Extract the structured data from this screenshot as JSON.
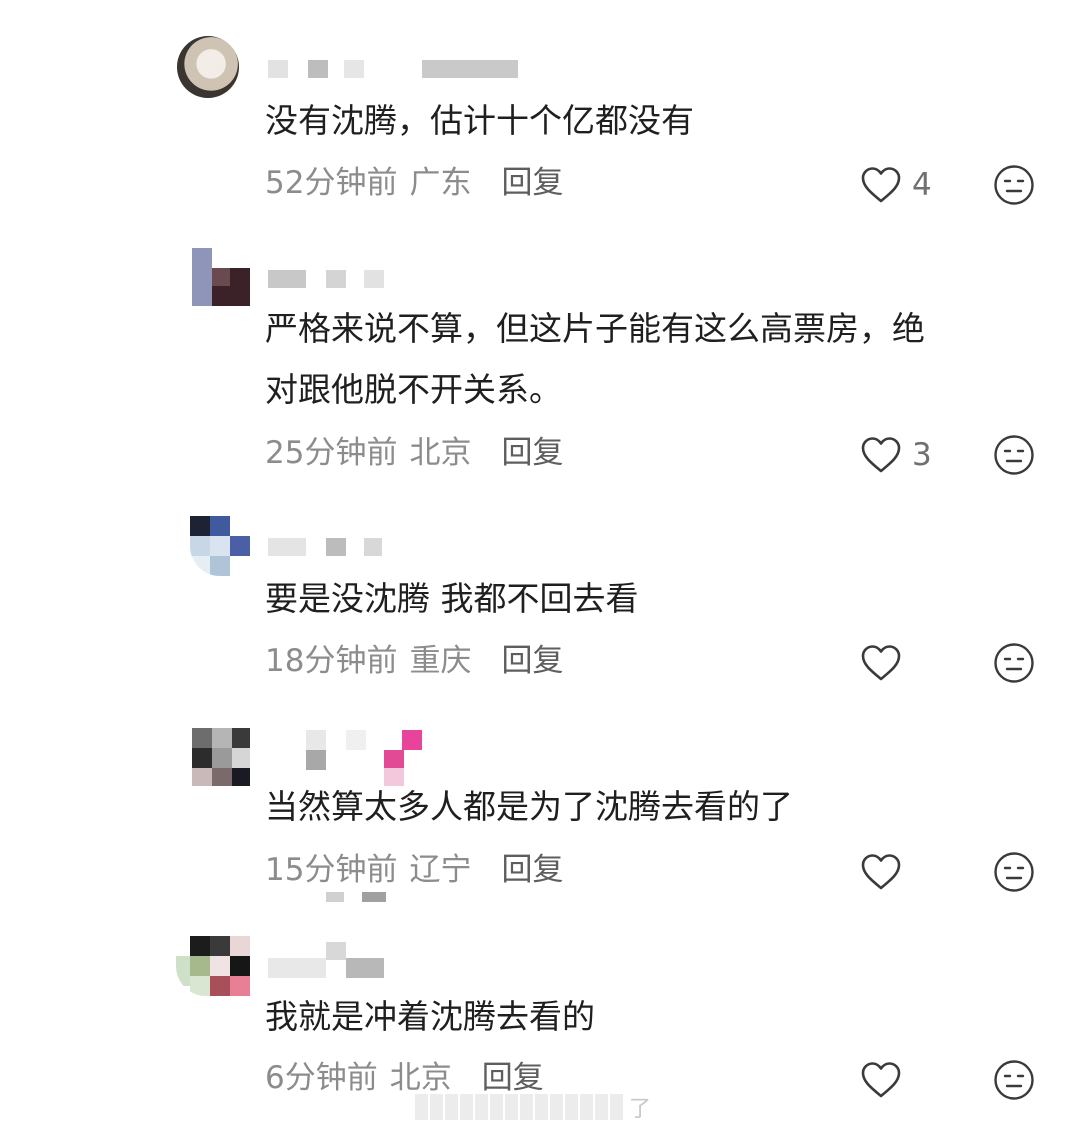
{
  "comments": [
    {
      "text": "没有沈腾，估计十个亿都没有",
      "time": "52分钟前",
      "location": "广东",
      "reply": "回复",
      "likes": "4"
    },
    {
      "text": "严格来说不算，但这片子能有这么高票房，绝\n对跟他脱不开关系。",
      "time": "25分钟前",
      "location": "北京",
      "reply": "回复",
      "likes": "3"
    },
    {
      "text": "要是没沈腾 我都不回去看",
      "time": "18分钟前",
      "location": "重庆",
      "reply": "回复",
      "likes": ""
    },
    {
      "text": "当然算太多人都是为了沈腾去看的了",
      "time": "15分钟前",
      "location": "辽宁",
      "reply": "回复",
      "likes": ""
    },
    {
      "text": "我就是冲着沈腾去看的",
      "time": "6分钟前",
      "location": "北京",
      "reply": "回复",
      "likes": ""
    }
  ],
  "watermark": {
    "suffix": "了"
  },
  "colors": {
    "text": "#1f1f1f",
    "meta": "#8c8c8c",
    "reply": "#5e5e5e",
    "icon": "#3a3a3a",
    "pixel_pink": "#e8459a"
  },
  "icons": {
    "like": "heart-outline-icon",
    "dislike": "neutral-face-icon"
  }
}
